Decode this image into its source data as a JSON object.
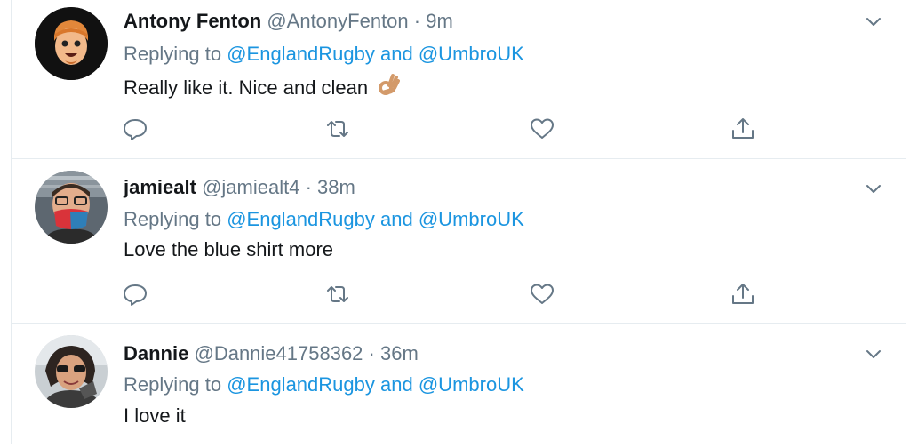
{
  "reply_label": "Replying to",
  "conjunction": "and",
  "colors": {
    "link": "#1b95e0",
    "muted": "#657786",
    "text": "#14171a",
    "divider": "#e6ecf0"
  },
  "tweets": [
    {
      "name": "Antony Fenton",
      "handle": "@AntonyFenton",
      "separator": "·",
      "time": "9m",
      "mention1": "@EnglandRugby",
      "mention2": "@UmbroUK",
      "text": "Really like it. Nice and clean",
      "emoji": "ok-hand-emoji"
    },
    {
      "name": "jamiealt",
      "handle": "@jamiealt4",
      "separator": "·",
      "time": "38m",
      "mention1": "@EnglandRugby",
      "mention2": "@UmbroUK",
      "text": "Love the blue shirt more"
    },
    {
      "name": "Dannie",
      "handle": "@Dannie41758362",
      "separator": "·",
      "time": "36m",
      "mention1": "@EnglandRugby",
      "mention2": "@UmbroUK",
      "text": "I love it"
    }
  ],
  "icons": [
    "reply-icon",
    "retweet-icon",
    "like-icon",
    "share-icon",
    "chevron-down-icon"
  ]
}
